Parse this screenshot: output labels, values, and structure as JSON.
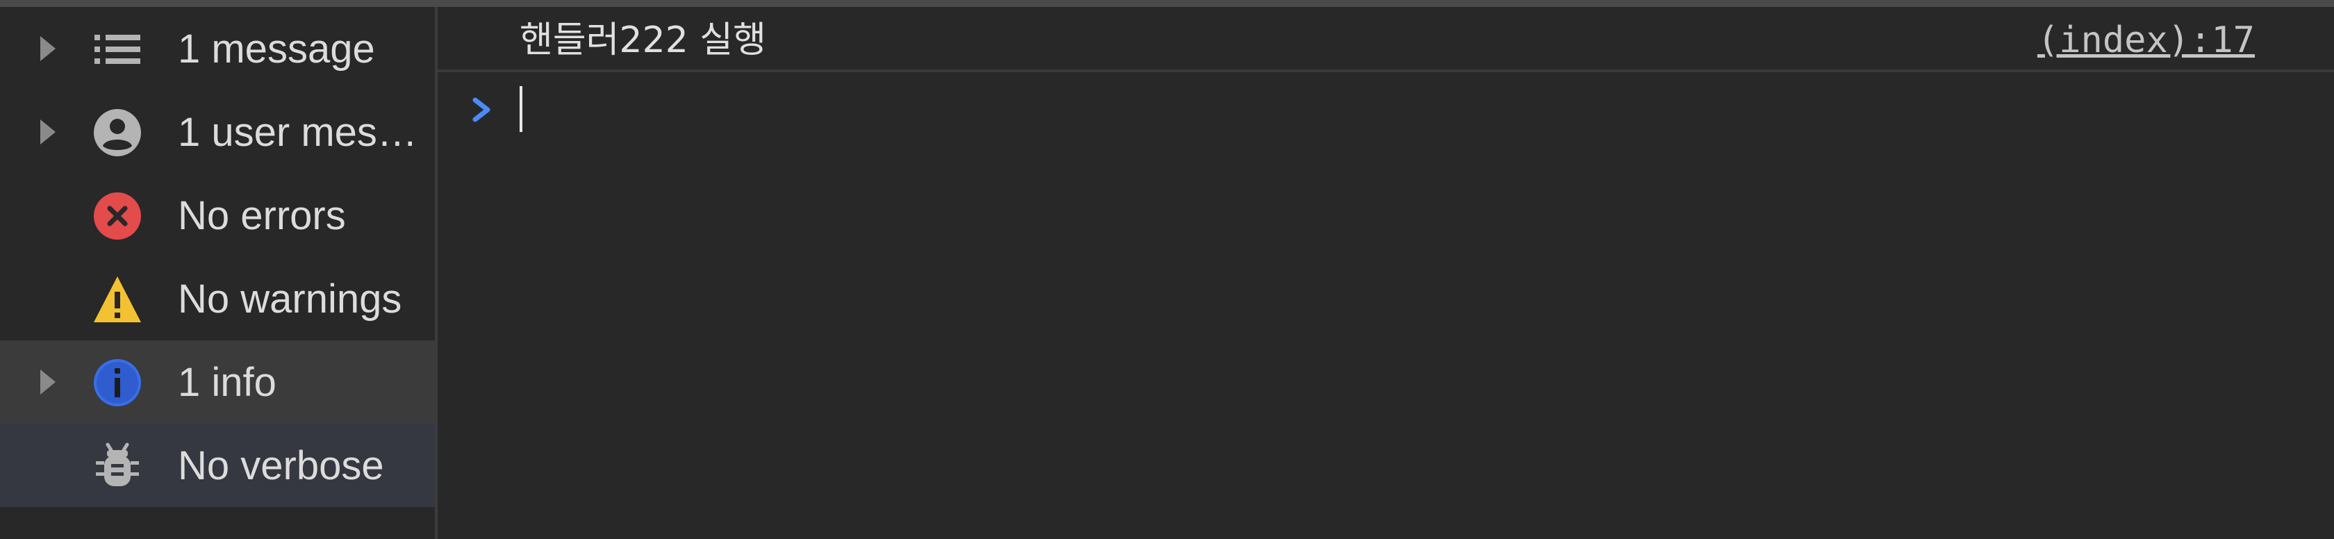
{
  "sidebar": {
    "items": [
      {
        "label": "1 message",
        "icon": "list-icon",
        "expandable": true
      },
      {
        "label": "1 user mes…",
        "icon": "user-circle-icon",
        "expandable": true
      },
      {
        "label": "No errors",
        "icon": "error-icon",
        "expandable": false,
        "icon_color": "#e44b4b"
      },
      {
        "label": "No warnings",
        "icon": "warning-icon",
        "expandable": false,
        "icon_color": "#f2c232"
      },
      {
        "label": "1 info",
        "icon": "info-icon",
        "expandable": true,
        "selected": true,
        "icon_color": "#3a6ee8"
      },
      {
        "label": "No verbose",
        "icon": "bug-icon",
        "expandable": false,
        "hovered": true
      }
    ]
  },
  "console": {
    "messages": [
      {
        "text": "핸들러222 실행",
        "source": "(index):17"
      }
    ],
    "prompt": {
      "value": "",
      "chevron_color": "#4a8cf7"
    }
  },
  "colors": {
    "background": "#282828",
    "selected_row": "#3b3b3b",
    "hovered_row": "#353840",
    "text": "#dcdcdc"
  }
}
